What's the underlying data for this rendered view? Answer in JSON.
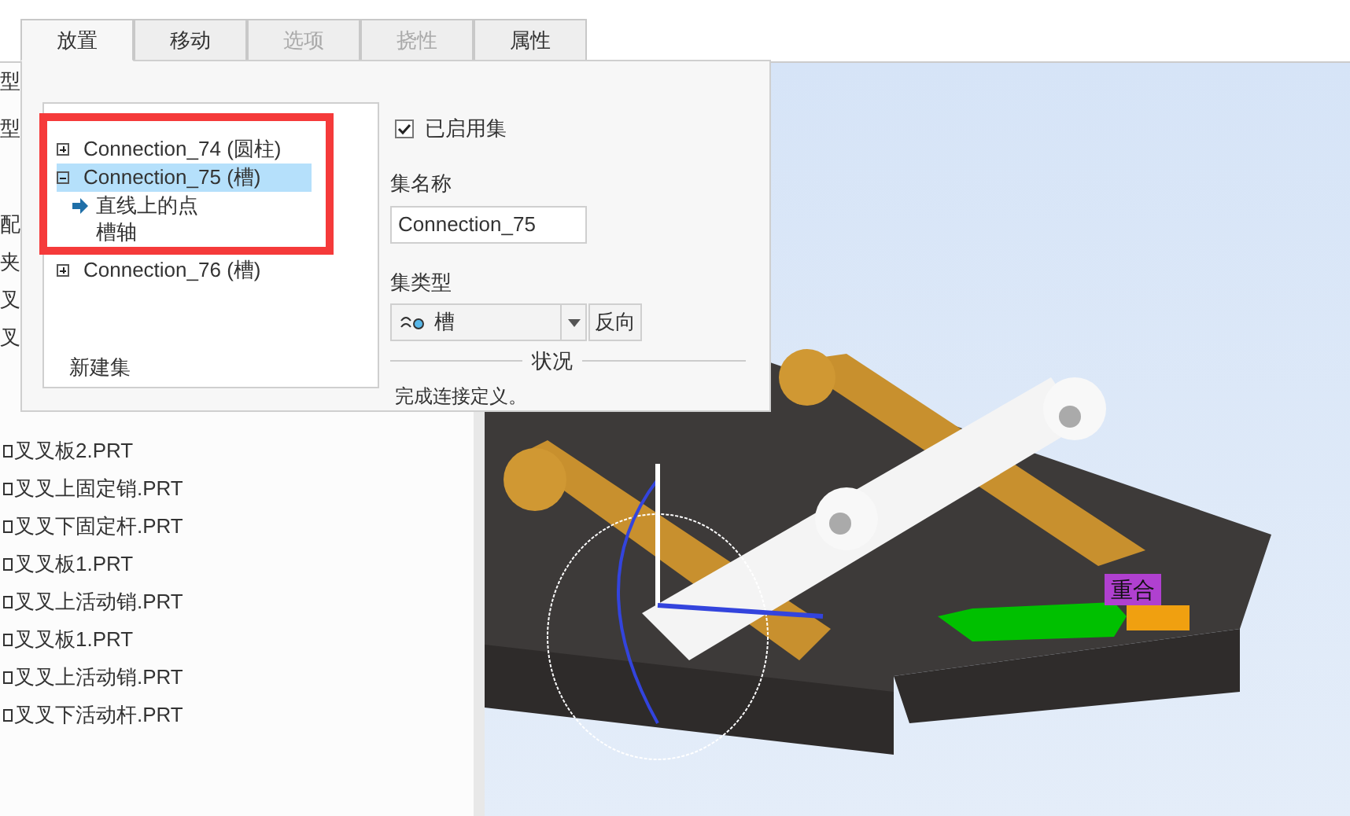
{
  "tabs": [
    {
      "label": "放置",
      "selected": true,
      "disabled": false
    },
    {
      "label": "移动",
      "selected": false,
      "disabled": false
    },
    {
      "label": "选项",
      "selected": false,
      "disabled": true
    },
    {
      "label": "挠性",
      "selected": false,
      "disabled": true
    },
    {
      "label": "属性",
      "selected": false,
      "disabled": false
    }
  ],
  "panel": {
    "tree": [
      {
        "label": "Connection_74 (圆柱)",
        "expanded": false,
        "selected": false
      },
      {
        "label": "Connection_75 (槽)",
        "expanded": true,
        "selected": true,
        "children": [
          {
            "label": "直线上的点",
            "active": true
          },
          {
            "label": "槽轴",
            "active": false
          }
        ]
      },
      {
        "label": "Connection_76 (槽)",
        "expanded": false,
        "selected": false
      }
    ],
    "new_set": "新建集",
    "enabled": {
      "label": "已启用集",
      "checked": true
    },
    "set_name": {
      "label": "集名称",
      "value": "Connection_75"
    },
    "set_type": {
      "label": "集类型",
      "value": "槽"
    },
    "flip_button": "反向",
    "status": {
      "title": "状况",
      "text": "完成连接定义。"
    }
  },
  "model_tree": {
    "top_fragments": [
      "型",
      "型"
    ],
    "fragments": [
      "配",
      "夹",
      "叉",
      "叉"
    ],
    "items": [
      "叉叉板2.PRT",
      "叉叉上固定销.PRT",
      "叉叉下固定杆.PRT",
      "叉叉板1.PRT",
      "叉叉上活动销.PRT",
      "叉叉板1.PRT",
      "叉叉上活动销.PRT",
      "叉叉下活动杆.PRT"
    ]
  },
  "viewport": {
    "callout": "重合"
  }
}
